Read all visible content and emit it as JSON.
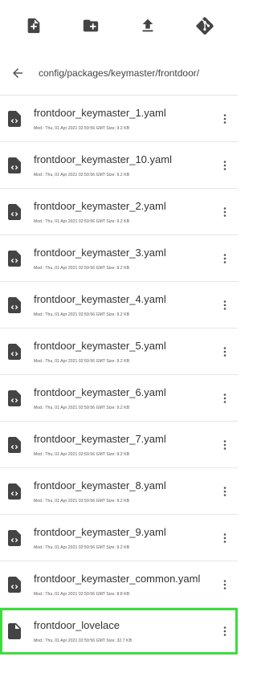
{
  "toolbar": {
    "icons": [
      "new-file-icon",
      "new-folder-icon",
      "upload-icon",
      "git-icon"
    ]
  },
  "path": {
    "current": "config/packages/keymaster/frontdoor/"
  },
  "files": [
    {
      "name": "frontdoor_keymaster_1.yaml",
      "meta": "Mod.: Thu, 01 Apr 2021 02:59:56 GMT  Size: 9.2 KB",
      "icon": "code-file-icon"
    },
    {
      "name": "frontdoor_keymaster_10.yaml",
      "meta": "Mod.: Thu, 01 Apr 2021 02:59:56 GMT  Size: 9.2 KB",
      "icon": "code-file-icon"
    },
    {
      "name": "frontdoor_keymaster_2.yaml",
      "meta": "Mod.: Thu, 01 Apr 2021 02:59:56 GMT  Size: 9.2 KB",
      "icon": "code-file-icon"
    },
    {
      "name": "frontdoor_keymaster_3.yaml",
      "meta": "Mod.: Thu, 01 Apr 2021 02:59:56 GMT  Size: 9.2 KB",
      "icon": "code-file-icon"
    },
    {
      "name": "frontdoor_keymaster_4.yaml",
      "meta": "Mod.: Thu, 01 Apr 2021 02:59:56 GMT  Size: 9.2 KB",
      "icon": "code-file-icon"
    },
    {
      "name": "frontdoor_keymaster_5.yaml",
      "meta": "Mod.: Thu, 01 Apr 2021 02:59:56 GMT  Size: 9.2 KB",
      "icon": "code-file-icon"
    },
    {
      "name": "frontdoor_keymaster_6.yaml",
      "meta": "Mod.: Thu, 01 Apr 2021 02:59:56 GMT  Size: 9.2 KB",
      "icon": "code-file-icon"
    },
    {
      "name": "frontdoor_keymaster_7.yaml",
      "meta": "Mod.: Thu, 01 Apr 2021 02:59:56 GMT  Size: 9.2 KB",
      "icon": "code-file-icon"
    },
    {
      "name": "frontdoor_keymaster_8.yaml",
      "meta": "Mod.: Thu, 01 Apr 2021 02:59:56 GMT  Size: 9.2 KB",
      "icon": "code-file-icon"
    },
    {
      "name": "frontdoor_keymaster_9.yaml",
      "meta": "Mod.: Thu, 01 Apr 2021 02:59:56 GMT  Size: 9.2 KB",
      "icon": "code-file-icon"
    },
    {
      "name": "frontdoor_keymaster_common.yaml",
      "meta": "Mod.: Thu, 01 Apr 2021 02:59:56 GMT  Size: 8.8 KB",
      "icon": "code-file-icon"
    },
    {
      "name": "frontdoor_lovelace",
      "meta": "Mod.: Thu, 01 Apr 2021 02:59:56 GMT  Size: 32.7 KB",
      "icon": "plain-file-icon",
      "selected": true
    }
  ],
  "colors": {
    "icon": "#444444",
    "divider": "#e6e6e6",
    "selection": "#3ddc3d"
  }
}
